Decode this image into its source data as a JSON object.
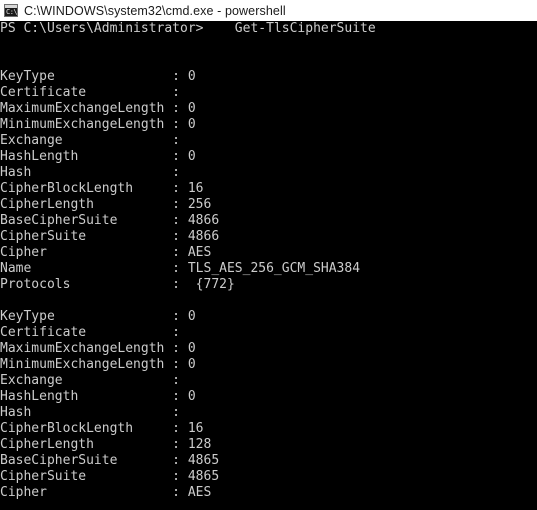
{
  "window": {
    "title": "C:\\WINDOWS\\system32\\cmd.exe - powershell",
    "icon": "cmd-console-icon",
    "icon_glyph": "C:\\",
    "titlebar_bg": "#ffffff",
    "titlebar_fg": "#1a1a1a",
    "console_bg": "#000000",
    "console_fg": "#cccccc"
  },
  "console": {
    "prompt": "PS C:\\Users\\Administrator>",
    "command": "Get-TlsCipherSuite",
    "prompt_line": "PS C:\\Users\\Administrator>    Get-TlsCipherSuite",
    "blocks": [
      {
        "name": "cipher-suite-block-1",
        "properties": [
          {
            "key": "KeyType",
            "value": "0"
          },
          {
            "key": "Certificate",
            "value": ""
          },
          {
            "key": "MaximumExchangeLength",
            "value": "0"
          },
          {
            "key": "MinimumExchangeLength",
            "value": "0"
          },
          {
            "key": "Exchange",
            "value": ""
          },
          {
            "key": "HashLength",
            "value": "0"
          },
          {
            "key": "Hash",
            "value": ""
          },
          {
            "key": "CipherBlockLength",
            "value": "16"
          },
          {
            "key": "CipherLength",
            "value": "256"
          },
          {
            "key": "BaseCipherSuite",
            "value": "4866"
          },
          {
            "key": "CipherSuite",
            "value": "4866"
          },
          {
            "key": "Cipher",
            "value": "AES"
          },
          {
            "key": "Name",
            "value": "TLS_AES_256_GCM_SHA384"
          },
          {
            "key": "Protocols",
            "value": " {772}"
          }
        ]
      },
      {
        "name": "cipher-suite-block-2",
        "properties": [
          {
            "key": "KeyType",
            "value": "0"
          },
          {
            "key": "Certificate",
            "value": ""
          },
          {
            "key": "MaximumExchangeLength",
            "value": "0"
          },
          {
            "key": "MinimumExchangeLength",
            "value": "0"
          },
          {
            "key": "Exchange",
            "value": ""
          },
          {
            "key": "HashLength",
            "value": "0"
          },
          {
            "key": "Hash",
            "value": ""
          },
          {
            "key": "CipherBlockLength",
            "value": "16"
          },
          {
            "key": "CipherLength",
            "value": "128"
          },
          {
            "key": "BaseCipherSuite",
            "value": "4865"
          },
          {
            "key": "CipherSuite",
            "value": "4865"
          },
          {
            "key": "Cipher",
            "value": "AES"
          }
        ]
      }
    ],
    "key_column_width": 22,
    "separator": ": "
  }
}
